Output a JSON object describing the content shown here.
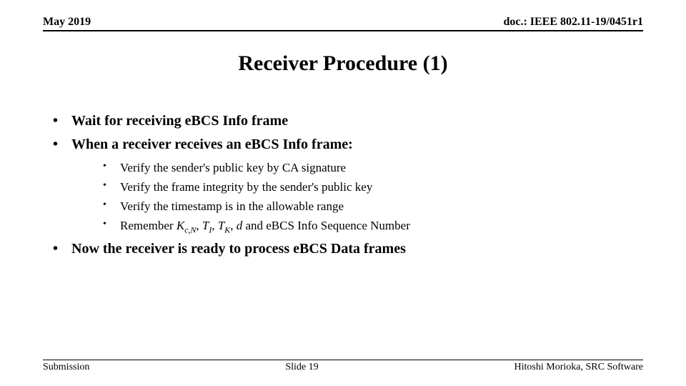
{
  "header": {
    "date": "May 2019",
    "doc_id": "doc.: IEEE 802.11-19/0451r1"
  },
  "title": "Receiver Procedure (1)",
  "bullets": {
    "b1": "Wait for receiving eBCS Info frame",
    "b2": "When a receiver receives an eBCS Info frame:",
    "s1": "Verify the sender's public key by CA signature",
    "s2": "Verify the frame integrity by the sender's public key",
    "s3": "Verify the timestamp is in the allowable range",
    "s4_prefix": "Remember ",
    "s4_k": "K",
    "s4_k_sub": "c,N",
    "s4_sep1": ", ",
    "s4_ti": "T",
    "s4_ti_sub": "I",
    "s4_sep2": ", ",
    "s4_tk": "T",
    "s4_tk_sub": "K",
    "s4_sep3": ", ",
    "s4_d": "d",
    "s4_suffix": " and eBCS Info Sequence Number",
    "b3": "Now the receiver is ready to process eBCS Data frames"
  },
  "footer": {
    "left": "Submission",
    "center": "Slide 19",
    "right": "Hitoshi Morioka, SRC Software"
  }
}
